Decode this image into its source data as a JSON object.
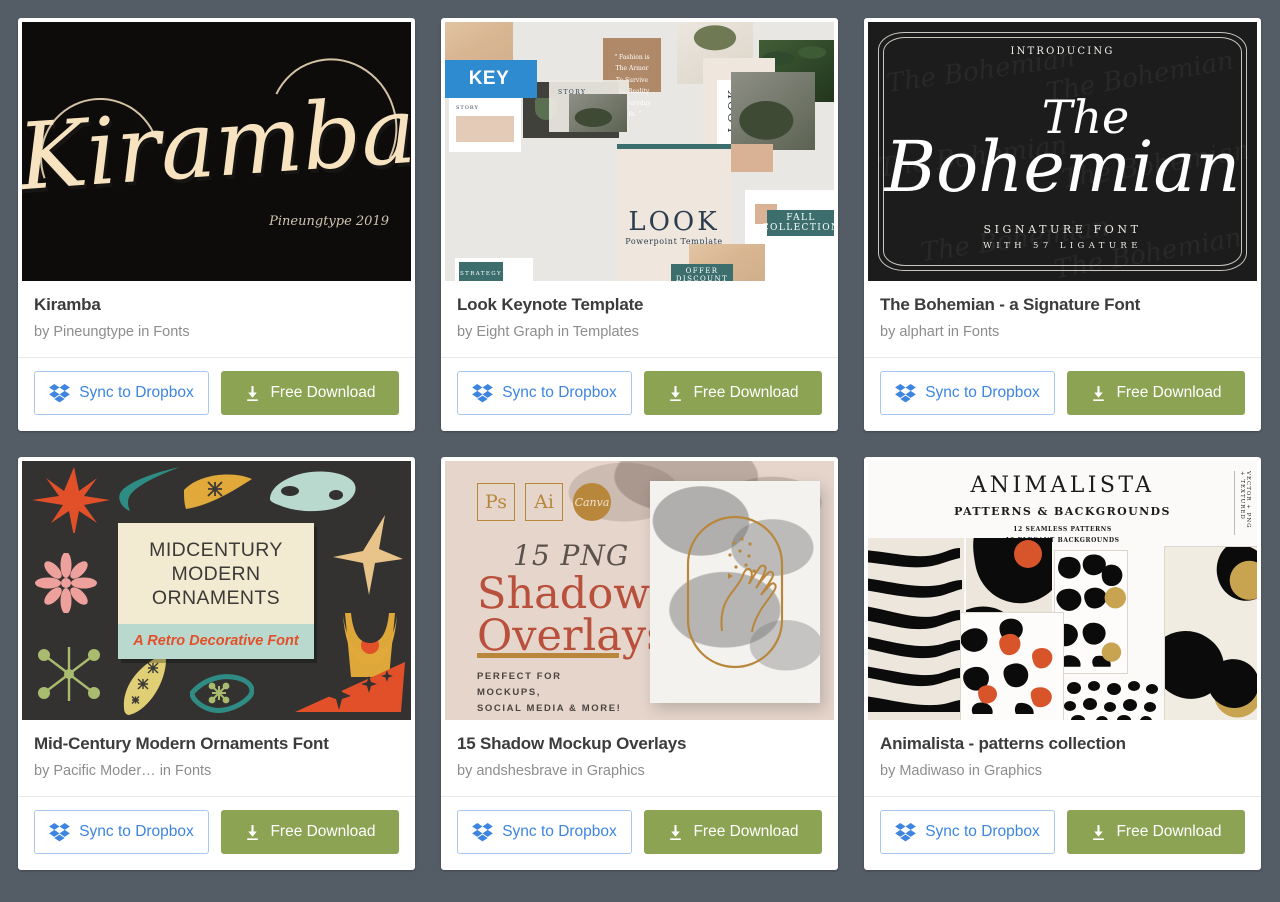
{
  "page": {
    "background_color": "#545c66",
    "accent_green": "#8ba352",
    "dropbox_blue": "#3d85e0"
  },
  "common": {
    "sync_label": "Sync to Dropbox",
    "download_label": "Free Download",
    "dropbox_icon": "dropbox-logo-icon",
    "download_icon": "download-arrow-icon"
  },
  "cards": [
    {
      "title": "Kiramba",
      "byline": "by Pineungtype in Fonts",
      "author": "Pineungtype",
      "category": "Fonts",
      "thumb": {
        "kind": "font-specimen",
        "script_word": "Kiramba",
        "credit": "Pineungtype 2019",
        "bg_color": "#0d0c0b",
        "ink_color": "#f7e3c0"
      }
    },
    {
      "title": "Look Keynote Template",
      "byline": "by Eight Graph in Templates",
      "author": "Eight Graph",
      "category": "Templates",
      "thumb": {
        "kind": "slide-collage",
        "badge": "KEY",
        "badge_color": "#2e8bd0",
        "quote": "\" Fashion is The Armor To Survive The Reality Of Everyday Life. \"",
        "brand": "LOOK",
        "brand_sub": "Powerpoint Template",
        "labels": [
          "STORY",
          "STORY",
          "LOOK",
          "FALL COLLECTION",
          "OFFER DISCOUNT",
          "STRATEGY"
        ],
        "bg_color": "#e9e7e4",
        "teal_color": "#3c6e6e",
        "tan_color": "#d9b194"
      }
    },
    {
      "title": "The Bohemian - a Signature Font",
      "byline": "by alphart in Fonts",
      "author": "alphart",
      "category": "Fonts",
      "thumb": {
        "kind": "font-specimen",
        "intro": "INTRODUCING",
        "line1": "The",
        "line2": "Bohemian",
        "sig1": "SIGNATURE FONT",
        "sig2": "WITH 57 LIGATURE",
        "watermark": "The Bohemian",
        "bg_color": "#1c1c1c",
        "ink_color": "#ffffff"
      }
    },
    {
      "title": "Mid-Century Modern Ornaments Font",
      "byline": "by Pacific Moder…  in Fonts",
      "author": "Pacific Moder…",
      "category": "Fonts",
      "thumb": {
        "kind": "ornament-poster",
        "line1": "MIDCENTURY",
        "line2": "MODERN",
        "line3": "ORNAMENTS",
        "tagline": "A Retro Decorative Font",
        "bg_color": "#333230",
        "plate_color": "#f3ead2",
        "band_color": "#b9d9cf",
        "tagline_color": "#e2502a",
        "palette": [
          "#e2502a",
          "#2f8c84",
          "#e0a93a",
          "#b9d9cf",
          "#eda09c",
          "#a9bb6e",
          "#e8c48a"
        ]
      }
    },
    {
      "title": "15 Shadow Mockup Overlays",
      "byline": "by andshesbrave in Graphics",
      "author": "andshesbrave",
      "category": "Graphics",
      "thumb": {
        "kind": "mockup-poster",
        "badges": [
          "Ps",
          "Ai",
          "Canva"
        ],
        "count_line": "15 PNG",
        "head1": "Shadow",
        "head2": "Overlays",
        "sub1": "PERFECT FOR MOCKUPS,",
        "sub2": "SOCIAL MEDIA & MORE!",
        "bg_color": "#e5d5cb",
        "gold_color": "#b8873b",
        "terracotta_color": "#b8503c"
      }
    },
    {
      "title": "Animalista - patterns collection",
      "byline": "by Madiwaso in Graphics",
      "author": "Madiwaso",
      "category": "Graphics",
      "thumb": {
        "kind": "pattern-collection",
        "head": "ANIMALISTA",
        "sub": "PATTERNS & BACKGROUNDS",
        "detail1": "12 SEAMLESS PATTERNS",
        "detail2": "12 ELEGANT BACKGROUNDS",
        "side_text": "VECTOR + PNG + TEXTURED",
        "bg_color": "#fbfaf8",
        "accent_color": "#d8542a",
        "gold_color": "#c5a martens",
        "gold": "#c8a451"
      }
    }
  ]
}
